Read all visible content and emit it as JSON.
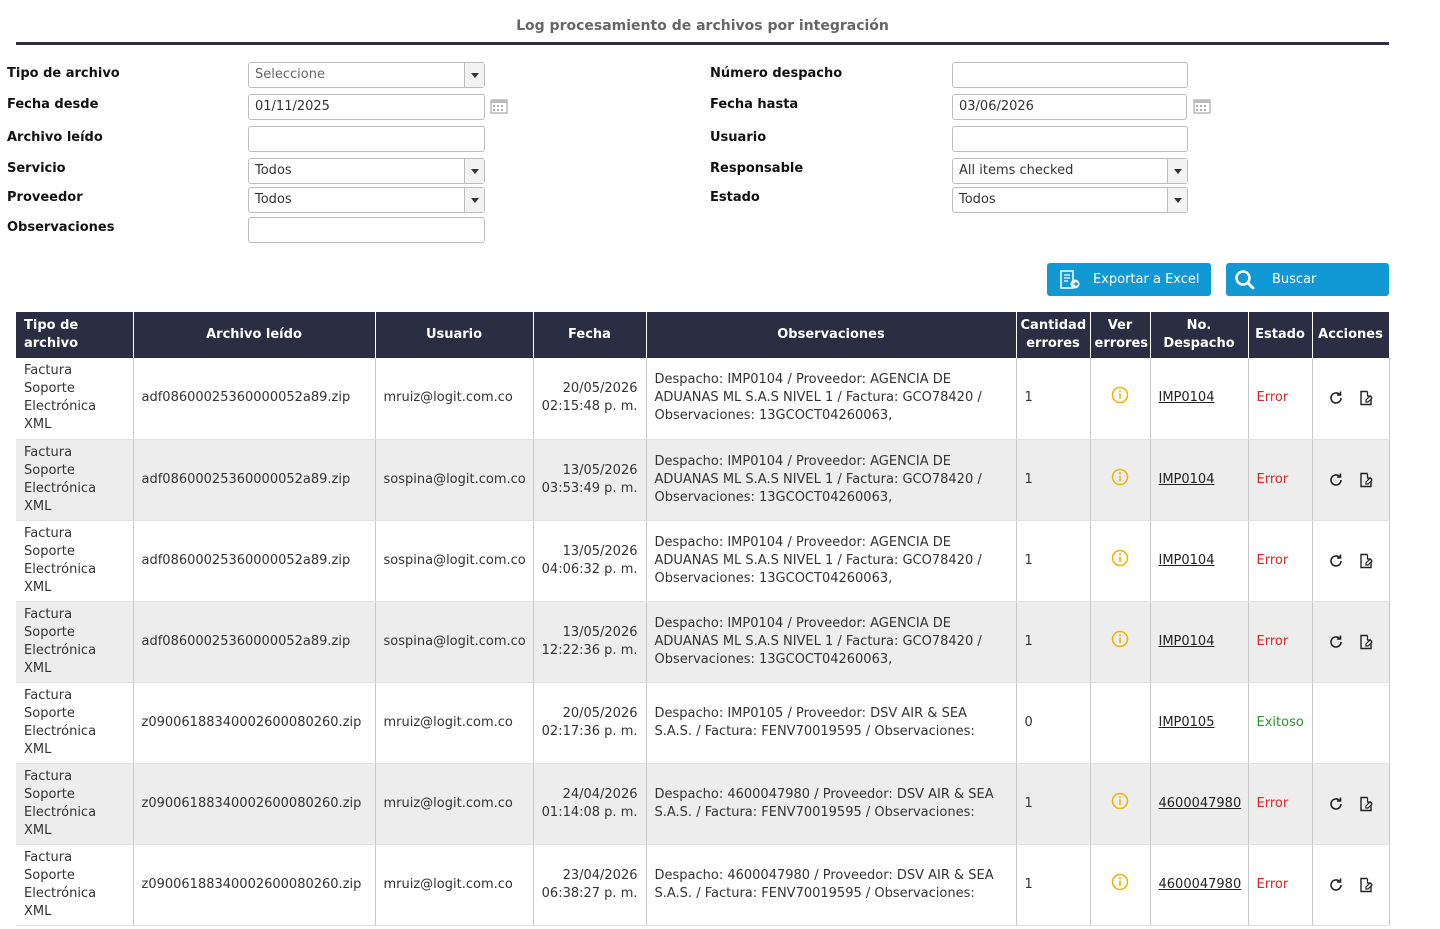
{
  "page": {
    "title": "Log procesamiento de archivos por integración"
  },
  "filters": {
    "tipo_archivo": {
      "label": "Tipo de archivo",
      "value": "Seleccione"
    },
    "numero_despacho": {
      "label": "Número despacho",
      "value": ""
    },
    "fecha_desde": {
      "label": "Fecha desde",
      "value": "01/11/2025"
    },
    "fecha_hasta": {
      "label": "Fecha hasta",
      "value": "03/06/2026"
    },
    "archivo_leido": {
      "label": "Archivo leído",
      "value": ""
    },
    "usuario": {
      "label": "Usuario",
      "value": ""
    },
    "servicio": {
      "label": "Servicio",
      "value": "Todos"
    },
    "responsable": {
      "label": "Responsable",
      "value": "All items checked"
    },
    "proveedor": {
      "label": "Proveedor",
      "value": "Todos"
    },
    "estado": {
      "label": "Estado",
      "value": "Todos"
    },
    "observaciones": {
      "label": "Observaciones",
      "value": ""
    }
  },
  "actions": {
    "export_label": "Exportar a Excel",
    "search_label": "Buscar"
  },
  "table": {
    "headers": {
      "tipo": "Tipo de archivo",
      "archivo": "Archivo leído",
      "usuario": "Usuario",
      "fecha": "Fecha",
      "observaciones": "Observaciones",
      "cantidad_1": "Cantidad",
      "cantidad_2": "errores",
      "ver_1": "Ver",
      "ver_2": "errores",
      "despacho": "No. Despacho",
      "estado": "Estado",
      "acciones": "Acciones"
    },
    "rows": [
      {
        "tipo": [
          "Factura",
          "Soporte",
          "Electrónica",
          "XML"
        ],
        "archivo": "adf08600025360000052a89.zip",
        "usuario": "mruiz@logit.com.co",
        "fecha": "20/05/2026",
        "hora": "02:15:48 p. m.",
        "observaciones": "Despacho: IMP0104 / Proveedor: AGENCIA DE ADUANAS ML S.A.S NIVEL 1 / Factura: GCO78420 / Observaciones: 13GCOCT04260063,",
        "cantidad": "1",
        "despacho": "IMP0104",
        "estado": "Error",
        "has_errors_icon": true,
        "has_actions": true
      },
      {
        "tipo": [
          "Factura",
          "Soporte",
          "Electrónica",
          "XML"
        ],
        "archivo": "adf08600025360000052a89.zip",
        "usuario": "sospina@logit.com.co",
        "fecha": "13/05/2026",
        "hora": "03:53:49 p. m.",
        "observaciones": "Despacho: IMP0104 / Proveedor: AGENCIA DE ADUANAS ML S.A.S NIVEL 1 / Factura: GCO78420 / Observaciones: 13GCOCT04260063,",
        "cantidad": "1",
        "despacho": "IMP0104",
        "estado": "Error",
        "has_errors_icon": true,
        "has_actions": true
      },
      {
        "tipo": [
          "Factura",
          "Soporte",
          "Electrónica",
          "XML"
        ],
        "archivo": "adf08600025360000052a89.zip",
        "usuario": "sospina@logit.com.co",
        "fecha": "13/05/2026",
        "hora": "04:06:32 p. m.",
        "observaciones": "Despacho: IMP0104 / Proveedor: AGENCIA DE ADUANAS ML S.A.S NIVEL 1 / Factura: GCO78420 / Observaciones: 13GCOCT04260063,",
        "cantidad": "1",
        "despacho": "IMP0104",
        "estado": "Error",
        "has_errors_icon": true,
        "has_actions": true
      },
      {
        "tipo": [
          "Factura",
          "Soporte",
          "Electrónica",
          "XML"
        ],
        "archivo": "adf08600025360000052a89.zip",
        "usuario": "sospina@logit.com.co",
        "fecha": "13/05/2026",
        "hora": "12:22:36 p. m.",
        "observaciones": "Despacho: IMP0104 / Proveedor: AGENCIA DE ADUANAS ML S.A.S NIVEL 1 / Factura: GCO78420 / Observaciones: 13GCOCT04260063,",
        "cantidad": "1",
        "despacho": "IMP0104",
        "estado": "Error",
        "has_errors_icon": true,
        "has_actions": true
      },
      {
        "tipo": [
          "Factura",
          "Soporte",
          "Electrónica",
          "XML"
        ],
        "archivo": "z09006188340002600080260.zip",
        "usuario": "mruiz@logit.com.co",
        "fecha": "20/05/2026",
        "hora": "02:17:36 p. m.",
        "observaciones": "Despacho: IMP0105 / Proveedor: DSV AIR & SEA S.A.S. / Factura: FENV70019595 / Observaciones:",
        "cantidad": "0",
        "despacho": "IMP0105",
        "estado": "Exitoso",
        "has_errors_icon": false,
        "has_actions": false
      },
      {
        "tipo": [
          "Factura",
          "Soporte",
          "Electrónica",
          "XML"
        ],
        "archivo": "z09006188340002600080260.zip",
        "usuario": "mruiz@logit.com.co",
        "fecha": "24/04/2026",
        "hora": "01:14:08 p. m.",
        "observaciones": "Despacho: 4600047980 / Proveedor: DSV AIR & SEA S.A.S. / Factura: FENV70019595 / Observaciones:",
        "cantidad": "1",
        "despacho": "4600047980",
        "estado": "Error",
        "has_errors_icon": true,
        "has_actions": true
      },
      {
        "tipo": [
          "Factura",
          "Soporte",
          "Electrónica",
          "XML"
        ],
        "archivo": "z09006188340002600080260.zip",
        "usuario": "mruiz@logit.com.co",
        "fecha": "23/04/2026",
        "hora": "06:38:27 p. m.",
        "observaciones": "Despacho: 4600047980 / Proveedor: DSV AIR & SEA S.A.S. / Factura: FENV70019595 / Observaciones:",
        "cantidad": "1",
        "despacho": "4600047980",
        "estado": "Error",
        "has_errors_icon": true,
        "has_actions": true
      }
    ]
  },
  "colors": {
    "header_bg": "#2b2d42",
    "button_bg": "#1199d5",
    "error": "#e02424",
    "success": "#2d8f2d",
    "info_icon": "#f0b400"
  },
  "icons": [
    "calendar-icon",
    "excel-export-icon",
    "search-icon",
    "info-icon",
    "refresh-icon",
    "edit-icon"
  ]
}
